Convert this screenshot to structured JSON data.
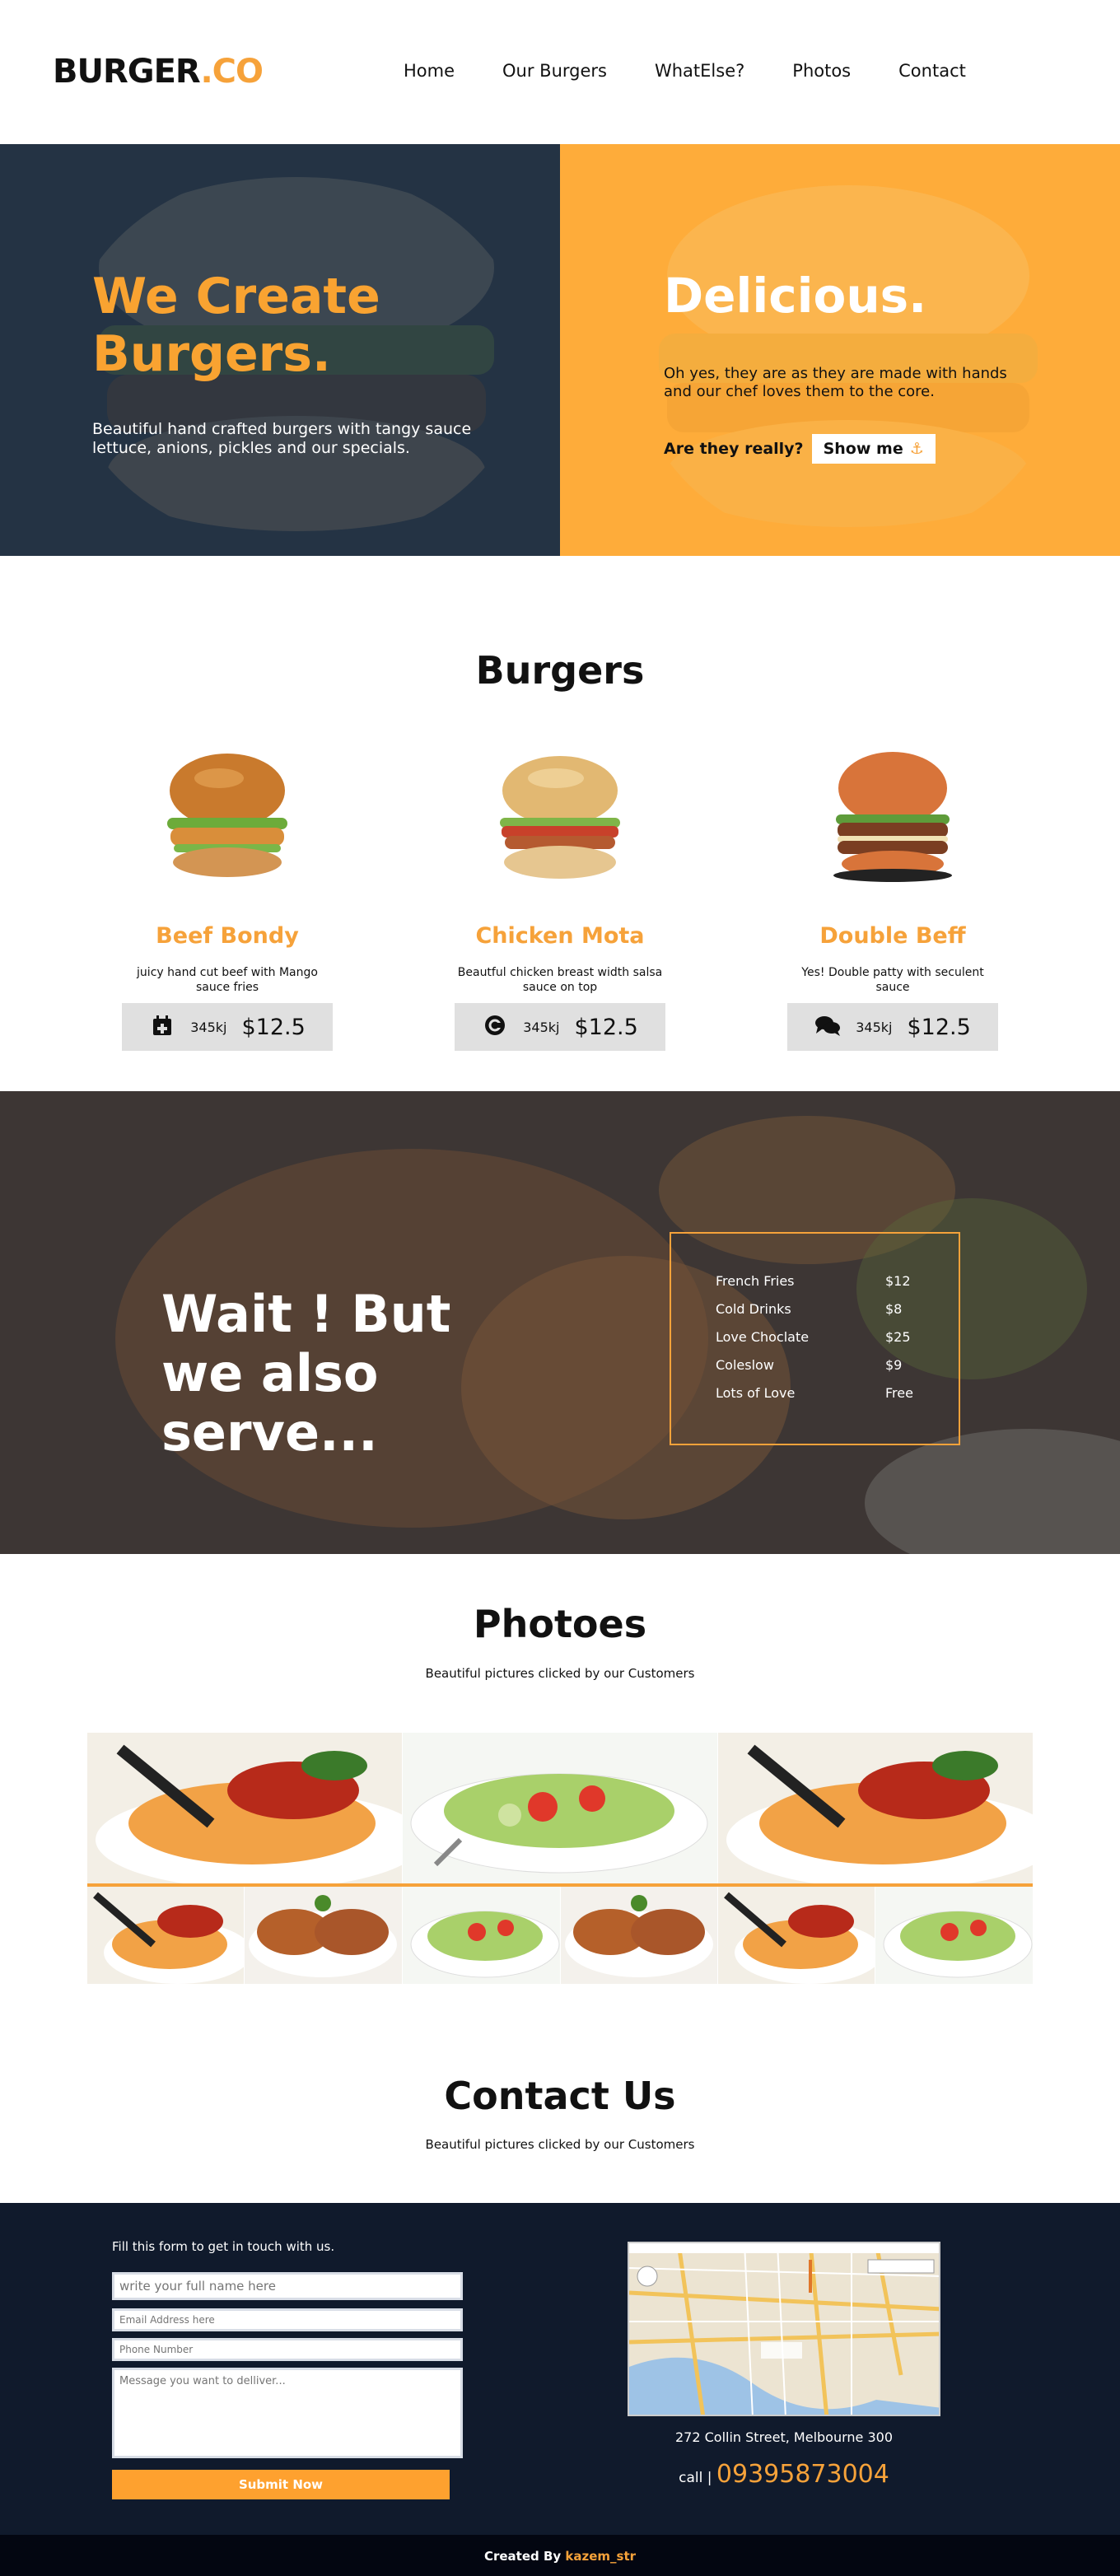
{
  "header": {
    "logo_main": "BURGER",
    "logo_accent": ".CO",
    "nav": [
      "Home",
      "Our Burgers",
      "WhatElse?",
      "Photos",
      "Contact"
    ]
  },
  "hero": {
    "left_title": "We Create Burgers.",
    "left_text": "Beautiful hand crafted burgers with tangy sauce lettuce, anions, pickles and our specials.",
    "right_title": "Delicious.",
    "right_text": "Oh yes, they are as they are made with hands and our chef loves them to the core.",
    "question": "Are they really?",
    "button_label": "Show me",
    "button_icon": "anchor-icon"
  },
  "burgers": {
    "title": "Burgers",
    "items": [
      {
        "name": "Beef Bondy",
        "desc": "juicy hand cut beef with Mango sauce fries",
        "kj": "345kj",
        "price": "$12.5",
        "icon": "calendar-plus-icon"
      },
      {
        "name": "Chicken Mota",
        "desc": "Beautful chicken breast width salsa sauce on top",
        "kj": "345kj",
        "price": "$12.5",
        "icon": "copyright-icon"
      },
      {
        "name": "Double Beff",
        "desc": "Yes! Double patty with seculent sauce",
        "kj": "345kj",
        "price": "$12.5",
        "icon": "comments-icon"
      }
    ]
  },
  "serve": {
    "title": "Wait ! But we also serve...",
    "menu": [
      {
        "name": "French Fries",
        "price": "$12"
      },
      {
        "name": "Cold Drinks",
        "price": "$8"
      },
      {
        "name": "Love Choclate",
        "price": "$25"
      },
      {
        "name": "Coleslow",
        "price": "$9"
      },
      {
        "name": "Lots of Love",
        "price": "Free"
      }
    ]
  },
  "photos": {
    "title": "Photoes",
    "subtitle": "Beautiful pictures clicked by our Customers"
  },
  "contact": {
    "title": "Contact Us",
    "subtitle": "Beautiful pictures clicked by our Customers",
    "form_intro": "Fill this form to get in touch with us.",
    "name_placeholder": "write your full name here",
    "email_placeholder": "Email Address here",
    "phone_placeholder": "Phone Number",
    "message_placeholder": "Message you want to delliver...",
    "submit_label": "Submit Now",
    "address": "272 Collin Street, Melbourne 300",
    "call_label": "call |",
    "phone": "09395873004"
  },
  "footer": {
    "created_by": "Created By",
    "author": "kazem_str"
  },
  "colors": {
    "accent": "#f6a23a",
    "hero_dark": "#243344",
    "hero_orange": "#feac3a",
    "contact_bg": "#101a2c",
    "footer_bg": "#030611"
  }
}
